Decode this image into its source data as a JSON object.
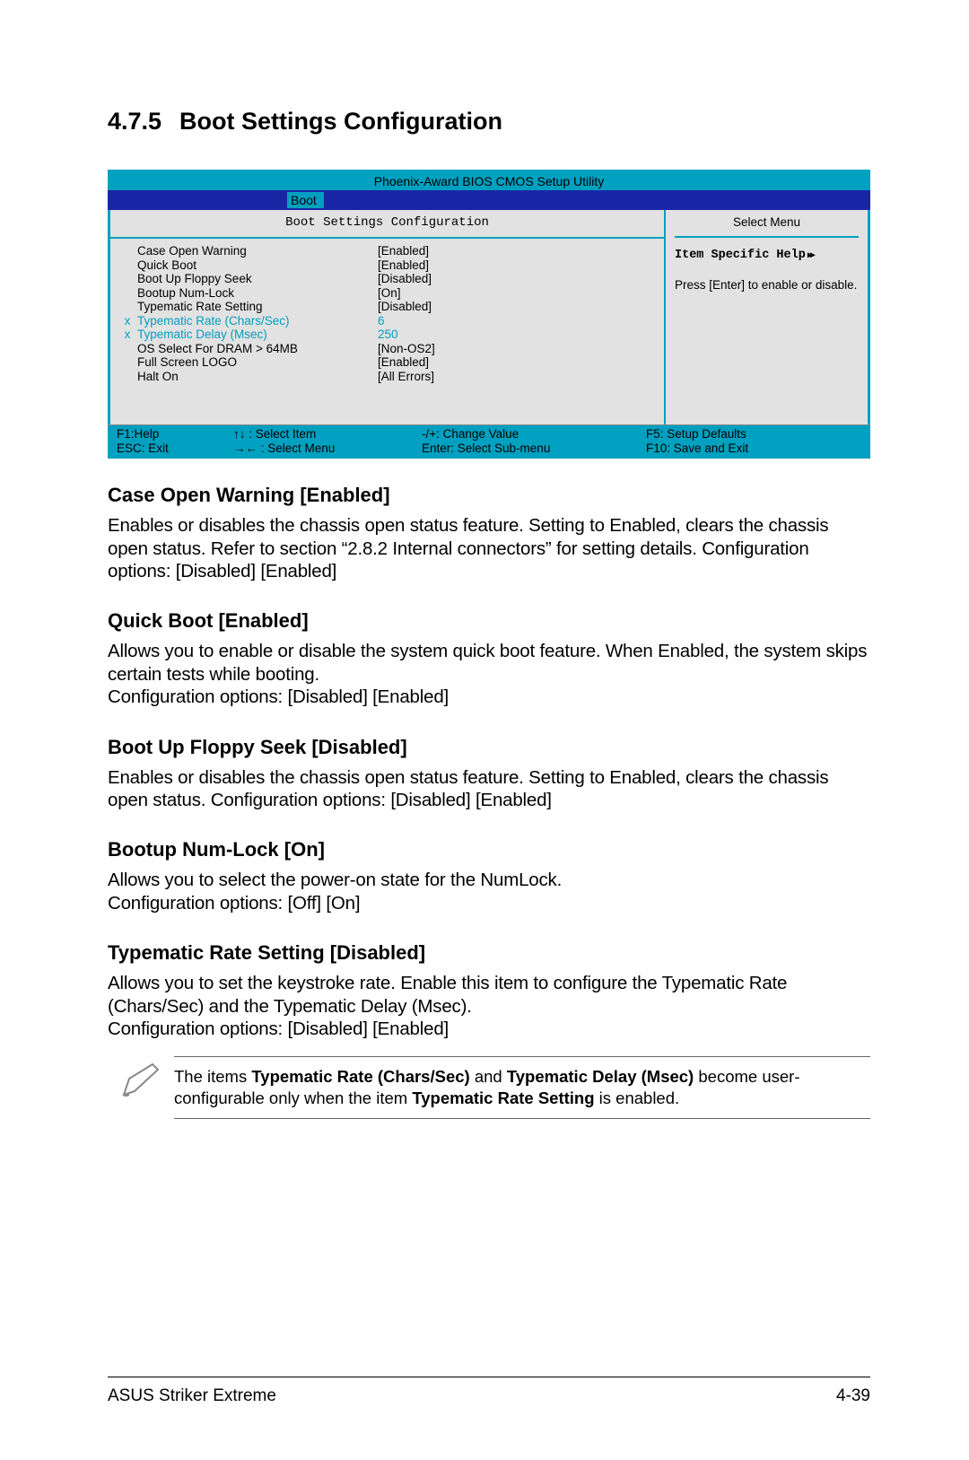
{
  "section": {
    "number": "4.7.5",
    "title": "Boot Settings Configuration"
  },
  "bios": {
    "header": "Phoenix-Award BIOS CMOS Setup Utility",
    "tab": "Boot",
    "subtitle": "Boot Settings Configuration",
    "side_title": "Select Menu",
    "help_title": "Item Specific Help",
    "help_text": "Press [Enter] to enable or disable.",
    "rows": [
      {
        "mark": "",
        "label": "Case Open Warning",
        "value": "[Enabled]",
        "disabled": false
      },
      {
        "mark": "",
        "label": "Quick Boot",
        "value": "[Enabled]",
        "disabled": false
      },
      {
        "mark": "",
        "label": "Boot Up Floppy Seek",
        "value": "[Disabled]",
        "disabled": false
      },
      {
        "mark": "",
        "label": "Bootup Num-Lock",
        "value": "[On]",
        "disabled": false
      },
      {
        "mark": "",
        "label": "Typematic Rate Setting",
        "value": "[Disabled]",
        "disabled": false
      },
      {
        "mark": "x",
        "label": "Typematic Rate (Chars/Sec)",
        "value": "6",
        "disabled": true
      },
      {
        "mark": "x",
        "label": "Typematic Delay (Msec)",
        "value": "250",
        "disabled": true
      },
      {
        "mark": "",
        "label": "OS Select For DRAM > 64MB",
        "value": "[Non-OS2]",
        "disabled": false
      },
      {
        "mark": "",
        "label": "Full Screen LOGO",
        "value": "[Enabled]",
        "disabled": false
      },
      {
        "mark": "",
        "label": "Halt On",
        "value": "[All Errors]",
        "disabled": false
      }
    ],
    "footer": {
      "c1a": "F1:Help",
      "c1b": "ESC: Exit",
      "c2a": "↑↓ : Select Item",
      "c2b": "→← : Select Menu",
      "c3a": "-/+: Change Value",
      "c3b": "Enter: Select Sub-menu",
      "c4a": "F5: Setup Defaults",
      "c4b": "F10: Save and Exit"
    }
  },
  "items": {
    "caseopen": {
      "heading": "Case Open Warning [Enabled]",
      "text": "Enables or disables the chassis open status feature. Setting to Enabled, clears the chassis open status. Refer to section “2.8.2 Internal connectors” for setting details. Configuration options: [Disabled] [Enabled]"
    },
    "quickboot": {
      "heading": "Quick Boot [Enabled]",
      "text": "Allows you to enable or disable the system quick boot feature. When Enabled, the system skips certain tests while booting.\nConfiguration options: [Disabled] [Enabled]"
    },
    "floppy": {
      "heading": "Boot Up Floppy Seek [Disabled]",
      "text": "Enables or disables the chassis open status feature. Setting to Enabled, clears the chassis open status. Configuration options: [Disabled] [Enabled]"
    },
    "numlock": {
      "heading": "Bootup Num-Lock [On]",
      "text": "Allows you to select the power-on state for the NumLock.\nConfiguration options: [Off] [On]"
    },
    "typematic": {
      "heading": "Typematic Rate Setting [Disabled]",
      "text": "Allows you to set the keystroke rate. Enable this item to configure the Typematic Rate (Chars/Sec) and the Typematic Delay (Msec).\nConfiguration options: [Disabled] [Enabled]"
    }
  },
  "note": {
    "pre": "The items ",
    "b1": "Typematic Rate (Chars/Sec)",
    "mid1": " and ",
    "b2": "Typematic Delay (Msec)",
    "mid2": " become user-configurable only when the item ",
    "b3": "Typematic Rate Setting",
    "post": " is enabled."
  },
  "footer": {
    "left": "ASUS Striker Extreme",
    "right": "4-39"
  }
}
